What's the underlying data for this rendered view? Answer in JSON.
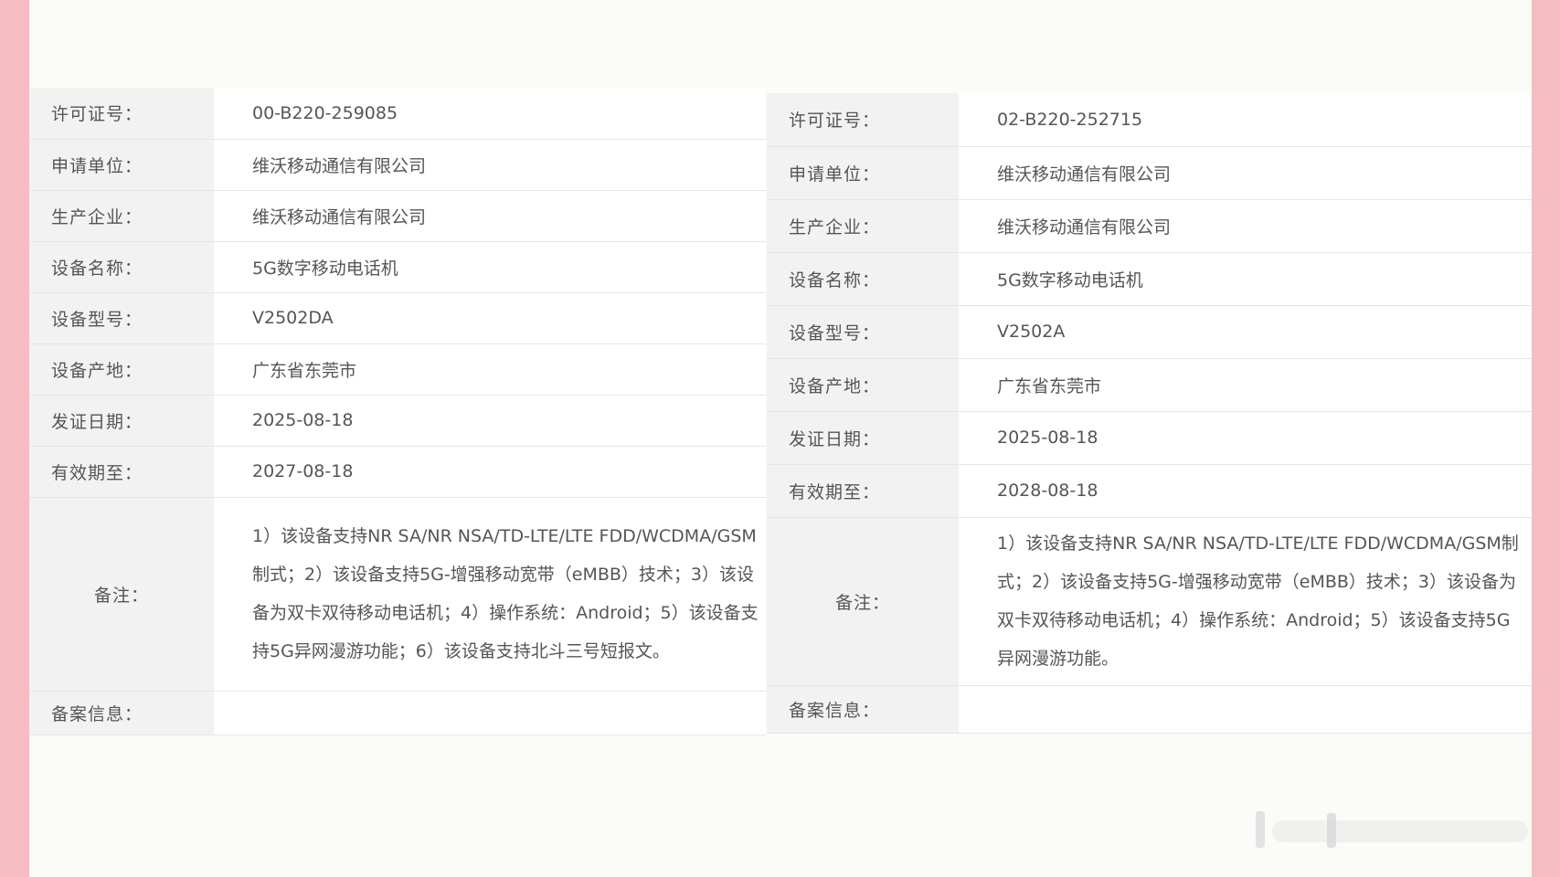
{
  "left": {
    "rows": [
      {
        "label": "许可证号：",
        "value": "00-B220-259085"
      },
      {
        "label": "申请单位：",
        "value": "维沃移动通信有限公司"
      },
      {
        "label": "生产企业：",
        "value": "维沃移动通信有限公司"
      },
      {
        "label": "设备名称：",
        "value": "5G数字移动电话机"
      },
      {
        "label": "设备型号：",
        "value": "V2502DA"
      },
      {
        "label": "设备产地：",
        "value": "广东省东莞市"
      },
      {
        "label": "发证日期：",
        "value": "2025-08-18"
      },
      {
        "label": "有效期至：",
        "value": "2027-08-18"
      }
    ],
    "remark": {
      "label": "备注：",
      "value": "1）该设备支持NR SA/NR NSA/TD-LTE/LTE FDD/WCDMA/GSM制式；2）该设备支持5G-增强移动宽带（eMBB）技术；3）该设备为双卡双待移动电话机；4）操作系统：Android；5）该设备支持5G异网漫游功能；6）该设备支持北斗三号短报文。"
    },
    "filing": {
      "label": "备案信息：",
      "value": ""
    }
  },
  "right": {
    "rows": [
      {
        "label": "许可证号：",
        "value": "02-B220-252715"
      },
      {
        "label": "申请单位：",
        "value": "维沃移动通信有限公司"
      },
      {
        "label": "生产企业：",
        "value": "维沃移动通信有限公司"
      },
      {
        "label": "设备名称：",
        "value": "5G数字移动电话机"
      },
      {
        "label": "设备型号：",
        "value": "V2502A"
      },
      {
        "label": "设备产地：",
        "value": "广东省东莞市"
      },
      {
        "label": "发证日期：",
        "value": "2025-08-18"
      },
      {
        "label": "有效期至：",
        "value": "2028-08-18"
      }
    ],
    "remark": {
      "label": "备注：",
      "value": "1）该设备支持NR SA/NR NSA/TD-LTE/LTE FDD/WCDMA/GSM制式；2）该设备支持5G-增强移动宽带（eMBB）技术；3）该设备为双卡双待移动电话机；4）操作系统：Android；5）该设备支持5G异网漫游功能。"
    },
    "filing": {
      "label": "备案信息：",
      "value": ""
    }
  },
  "colors": {
    "background": "#f6bcc2",
    "page": "#fbfbf8",
    "label_cell": "#f2f2f2",
    "value_cell": "#ffffff",
    "text": "#555555",
    "border": "#e6e6e6"
  }
}
